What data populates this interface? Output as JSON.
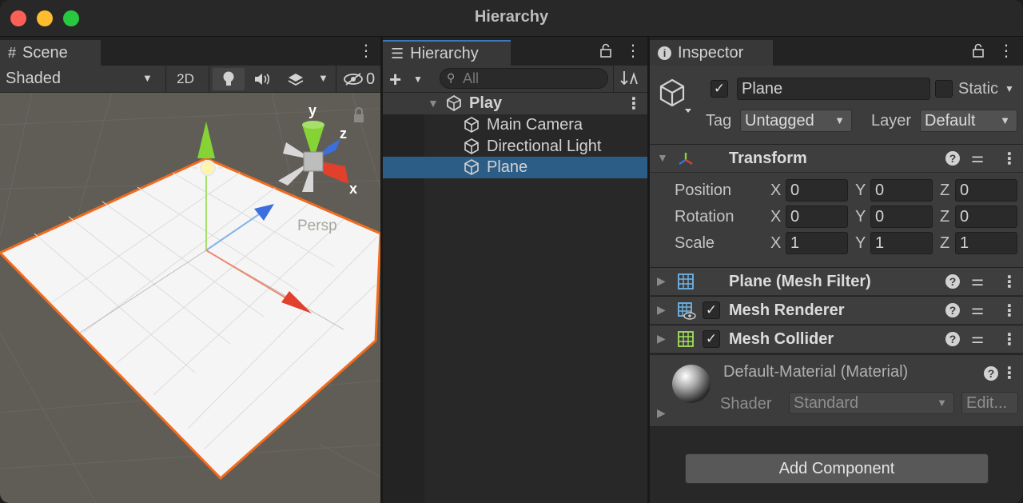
{
  "window": {
    "title": "Hierarchy"
  },
  "scene": {
    "tab_label": "Scene",
    "shading_mode": "Shaded",
    "btn_2d": "2D",
    "hidden_count": "0",
    "gizmo_labels": {
      "y": "y",
      "z": "z",
      "x": "x"
    },
    "projection_label": "Persp"
  },
  "hierarchy": {
    "tab_label": "Hierarchy",
    "search_placeholder": "All",
    "scene_name": "Play",
    "items": [
      {
        "label": "Main Camera",
        "selected": false
      },
      {
        "label": "Directional Light",
        "selected": false
      },
      {
        "label": "Plane",
        "selected": true
      }
    ]
  },
  "inspector": {
    "tab_label": "Inspector",
    "object_name": "Plane",
    "static_label": "Static",
    "tag_label": "Tag",
    "tag_value": "Untagged",
    "layer_label": "Layer",
    "layer_value": "Default",
    "transform": {
      "title": "Transform",
      "rows": [
        {
          "label": "Position",
          "x": "0",
          "y": "0",
          "z": "0"
        },
        {
          "label": "Rotation",
          "x": "0",
          "y": "0",
          "z": "0"
        },
        {
          "label": "Scale",
          "x": "1",
          "y": "1",
          "z": "1"
        }
      ],
      "axis_x": "X",
      "axis_y": "Y",
      "axis_z": "Z"
    },
    "components": [
      {
        "title": "Plane (Mesh Filter)"
      },
      {
        "title": "Mesh Renderer"
      },
      {
        "title": "Mesh Collider"
      }
    ],
    "material": {
      "name": "Default-Material (Material)",
      "shader_label": "Shader",
      "shader_value": "Standard",
      "edit_label": "Edit..."
    },
    "add_component_label": "Add Component"
  },
  "colors": {
    "selection": "#2c5d87",
    "accent_tab": "#3a79bb",
    "plane_outline": "#f26b1d",
    "axis_x": "#e0402c",
    "axis_y": "#8fd93a",
    "axis_z": "#3b6fe0"
  }
}
